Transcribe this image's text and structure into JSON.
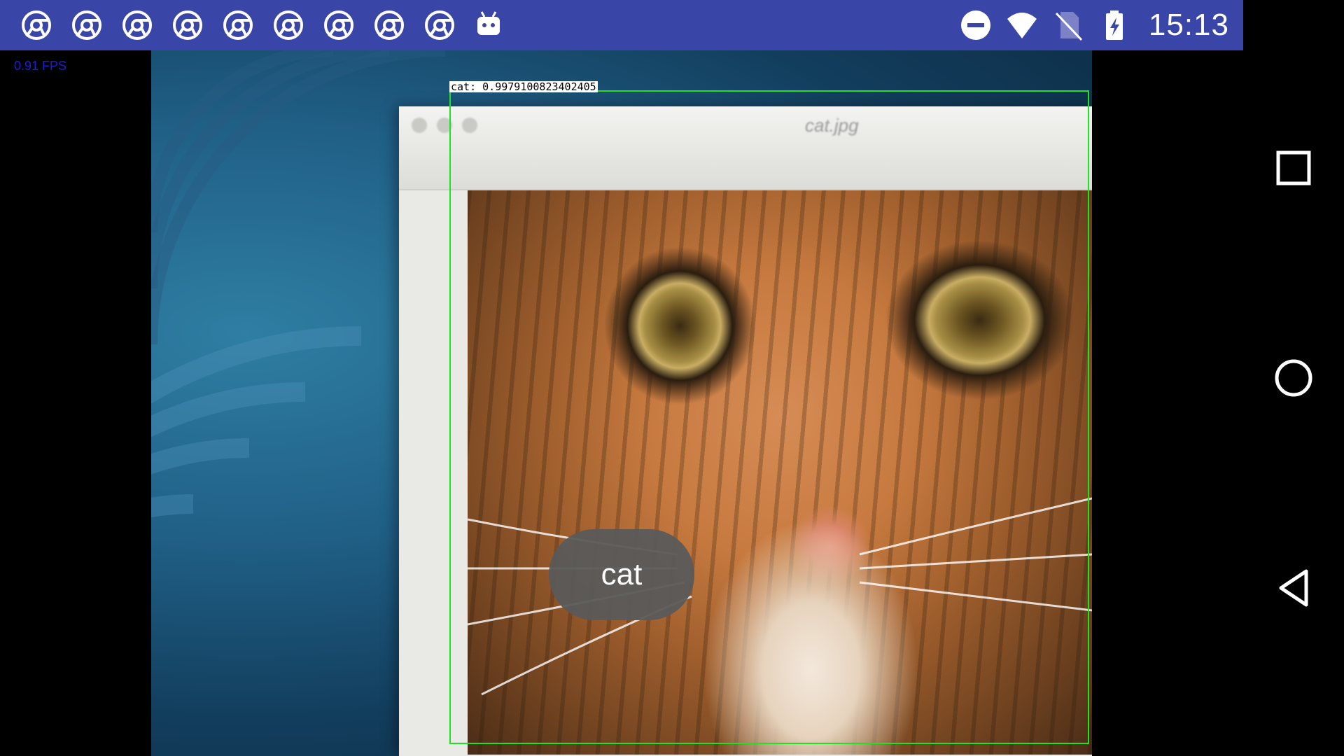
{
  "status_bar": {
    "time": "15:13",
    "notification_icons": [
      "chrome-icon",
      "chrome-icon",
      "chrome-icon",
      "chrome-icon",
      "chrome-icon",
      "chrome-icon",
      "chrome-icon",
      "chrome-icon",
      "chrome-icon",
      "android-icon"
    ],
    "status_icons": [
      "do-not-disturb-icon",
      "wifi-icon",
      "no-sim-icon",
      "battery-charging-icon"
    ],
    "background_color": "#3a45a8"
  },
  "camera": {
    "fps_text": "0.91 FPS",
    "detection": {
      "label_text": "cat: 0.9979100823402405",
      "box_color": "#22e022"
    },
    "photo_window_title": "cat.jpg",
    "toast_text": "cat"
  },
  "nav_bar": {
    "buttons": [
      "recents-button",
      "home-button",
      "back-button"
    ]
  }
}
